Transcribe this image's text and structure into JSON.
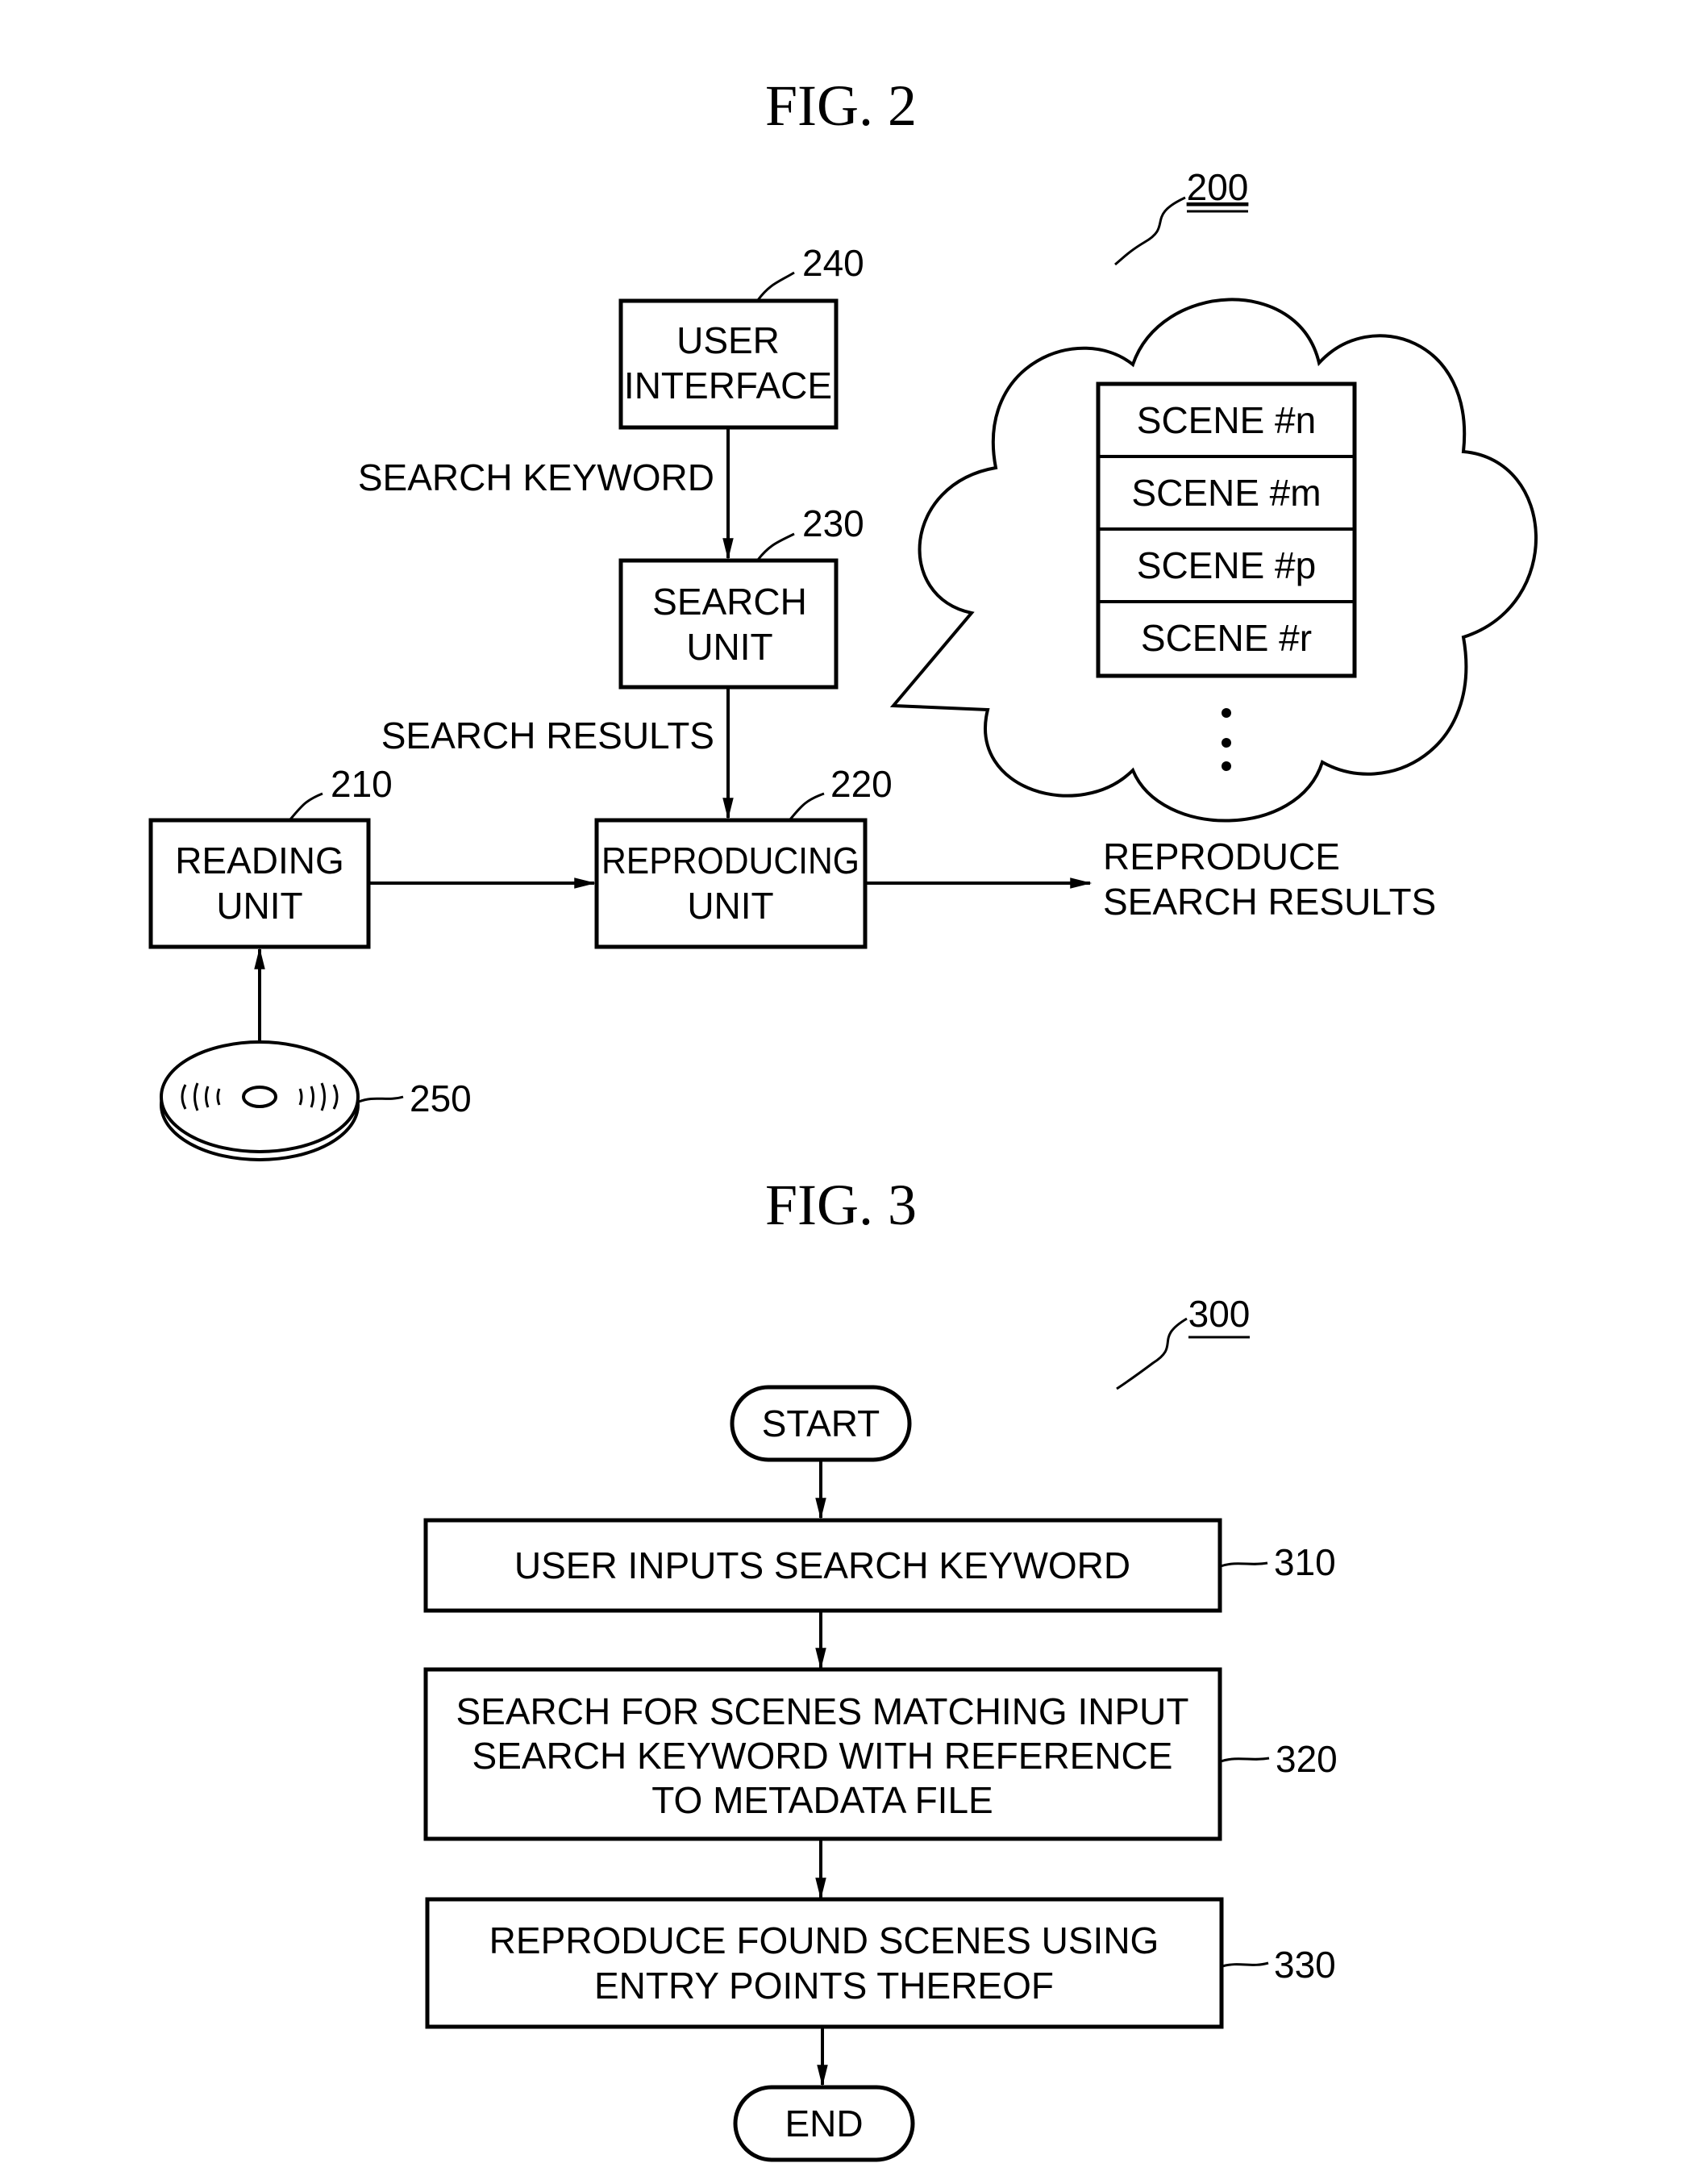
{
  "fig2": {
    "title": "FIG. 2",
    "ref_main": "200",
    "user_interface": {
      "line1": "USER",
      "line2": "INTERFACE",
      "ref": "240"
    },
    "search_unit": {
      "line1": "SEARCH",
      "line2": "UNIT",
      "ref": "230"
    },
    "reproducing_unit": {
      "line1": "REPRODUCING",
      "line2": "UNIT",
      "ref": "220"
    },
    "reading_unit": {
      "line1": "READING",
      "line2": "UNIT",
      "ref": "210"
    },
    "disc": {
      "ref": "250"
    },
    "search_keyword_label": "SEARCH KEYWORD",
    "search_results_label": "SEARCH RESULTS",
    "output": {
      "line1": "REPRODUCE",
      "line2": "SEARCH RESULTS"
    },
    "scenes": [
      "SCENE #n",
      "SCENE #m",
      "SCENE #p",
      "SCENE #r"
    ]
  },
  "fig3": {
    "title": "FIG. 3",
    "ref_main": "300",
    "start": "START",
    "end": "END",
    "steps": [
      {
        "ref": "310",
        "lines": [
          "USER INPUTS SEARCH KEYWORD"
        ]
      },
      {
        "ref": "320",
        "lines": [
          "SEARCH FOR SCENES MATCHING INPUT",
          "SEARCH KEYWORD WITH REFERENCE",
          "TO METADATA FILE"
        ]
      },
      {
        "ref": "330",
        "lines": [
          "REPRODUCE FOUND SCENES USING",
          "ENTRY POINTS THEREOF"
        ]
      }
    ]
  }
}
